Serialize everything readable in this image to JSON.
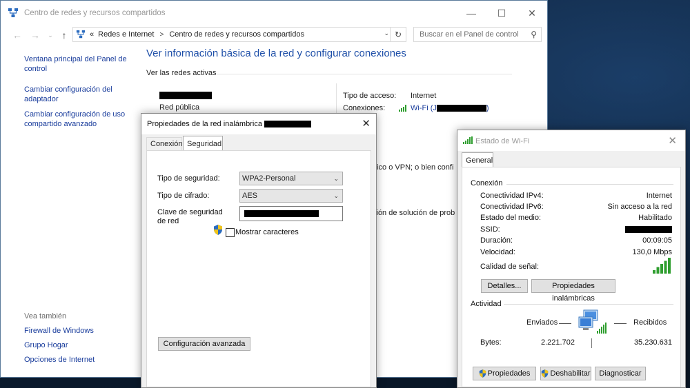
{
  "main_window": {
    "title": "Centro de redes y recursos compartidos",
    "controls": {
      "minimize": "—",
      "maximize": "☐",
      "close": "✕"
    },
    "address": {
      "prefix": "«",
      "crumbs": [
        "Redes e Internet",
        "Centro de redes y recursos compartidos"
      ],
      "separator": ">"
    },
    "search": {
      "placeholder": "Buscar en el Panel de control"
    },
    "left_links": [
      "Ventana principal del Panel de control",
      "Cambiar configuración del adaptador",
      "Cambiar configuración de uso compartido avanzado"
    ],
    "see_also": {
      "header": "Vea también",
      "links": [
        "Firewall de Windows",
        "Grupo Hogar",
        "Opciones de Internet"
      ]
    },
    "heading": "Ver información básica de la red y configurar conexiones",
    "active_networks_label": "Ver las redes activas",
    "network_type": "Red pública",
    "access_type_label": "Tipo de acceso:",
    "access_type_value": "Internet",
    "connections_label": "Conexiones:",
    "connections_value_prefix": "Wi-Fi (J",
    "connections_value_suffix": ")",
    "partial_text_1": "nico o VPN; o bien confi",
    "partial_text_2": "ción de solución de prob"
  },
  "props_dialog": {
    "title": "Propiedades de la red inalámbrica",
    "close": "✕",
    "tabs": [
      "Conexión",
      "Seguridad"
    ],
    "active_tab": "Seguridad",
    "security_type_label": "Tipo de seguridad:",
    "security_type_value": "WPA2-Personal",
    "cipher_label": "Tipo de cifrado:",
    "cipher_value": "AES",
    "key_label": "Clave de seguridad de red",
    "show_chars_label": "Mostrar caracteres",
    "show_chars_checked": false,
    "advanced_button": "Configuración avanzada"
  },
  "wifi_dialog": {
    "title": "Estado de Wi-Fi",
    "close": "✕",
    "tab": "General",
    "connection_group": "Conexión",
    "rows": [
      {
        "label": "Conectividad IPv4:",
        "value": "Internet"
      },
      {
        "label": "Conectividad IPv6:",
        "value": "Sin acceso a la red"
      },
      {
        "label": "Estado del medio:",
        "value": "Habilitado"
      },
      {
        "label": "SSID:",
        "value": ""
      },
      {
        "label": "Duración:",
        "value": "00:09:05"
      },
      {
        "label": "Velocidad:",
        "value": "130,0 Mbps"
      }
    ],
    "signal_label": "Calidad de señal:",
    "signal_bars": 5,
    "details_button": "Detalles...",
    "wireless_props_button": "Propiedades inalámbricas",
    "activity_group": "Actividad",
    "sent_label": "Enviados",
    "received_label": "Recibidos",
    "bytes_label": "Bytes:",
    "bytes_sent": "2.221.702",
    "bytes_received": "35.230.631",
    "properties_button": "Propiedades",
    "disable_button": "Deshabilitar",
    "diagnose_button": "Diagnosticar"
  },
  "colors": {
    "link": "#1a3d9c",
    "heading": "#1e4fa8",
    "signal_green": "#2f9e2f"
  }
}
